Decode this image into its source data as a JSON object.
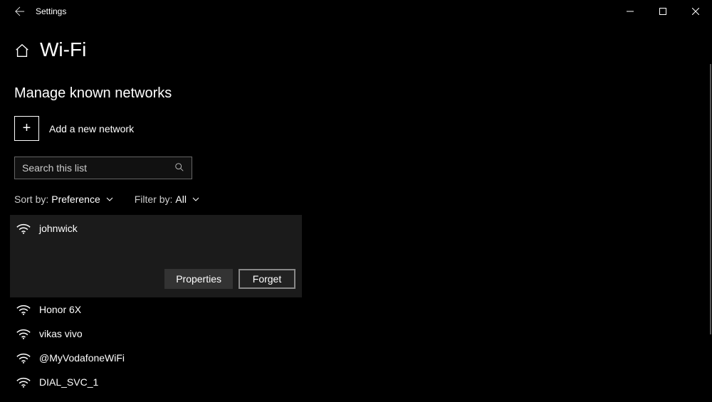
{
  "titlebar": {
    "app_title": "Settings"
  },
  "page": {
    "title": "Wi-Fi",
    "section_title": "Manage known networks",
    "add_network_label": "Add a new network",
    "search_placeholder": "Search this list",
    "sort_label": "Sort by:",
    "sort_value": "Preference",
    "filter_label": "Filter by:",
    "filter_value": "All"
  },
  "networks": [
    {
      "name": "johnwick",
      "selected": true
    },
    {
      "name": "Honor 6X",
      "selected": false
    },
    {
      "name": "vikas vivo",
      "selected": false
    },
    {
      "name": "@MyVodafoneWiFi",
      "selected": false
    },
    {
      "name": "DIAL_SVC_1",
      "selected": false
    }
  ],
  "buttons": {
    "properties": "Properties",
    "forget": "Forget"
  }
}
